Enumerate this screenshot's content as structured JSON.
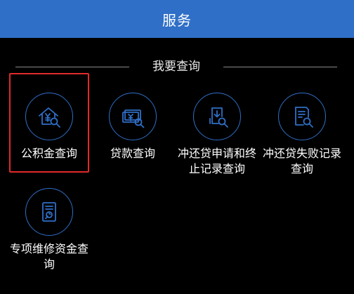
{
  "header": {
    "title": "服务"
  },
  "section": {
    "title": "我要查询"
  },
  "tiles": [
    {
      "label": "公积金查询",
      "icon": "house-search-icon",
      "highlighted": true
    },
    {
      "label": "贷款查询",
      "icon": "money-search-icon",
      "highlighted": false
    },
    {
      "label": "冲还贷申请和终止记录查询",
      "icon": "download-search-icon",
      "highlighted": false
    },
    {
      "label": "冲还贷失败记录查询",
      "icon": "document-search-icon",
      "highlighted": false
    },
    {
      "label": "专项维修资金查询",
      "icon": "wrench-document-icon",
      "highlighted": false
    }
  ],
  "colors": {
    "header_bg": "#2f6fc7",
    "icon_accent": "#2f6fc7",
    "highlight_border": "#e02a2a",
    "background": "#000000"
  }
}
